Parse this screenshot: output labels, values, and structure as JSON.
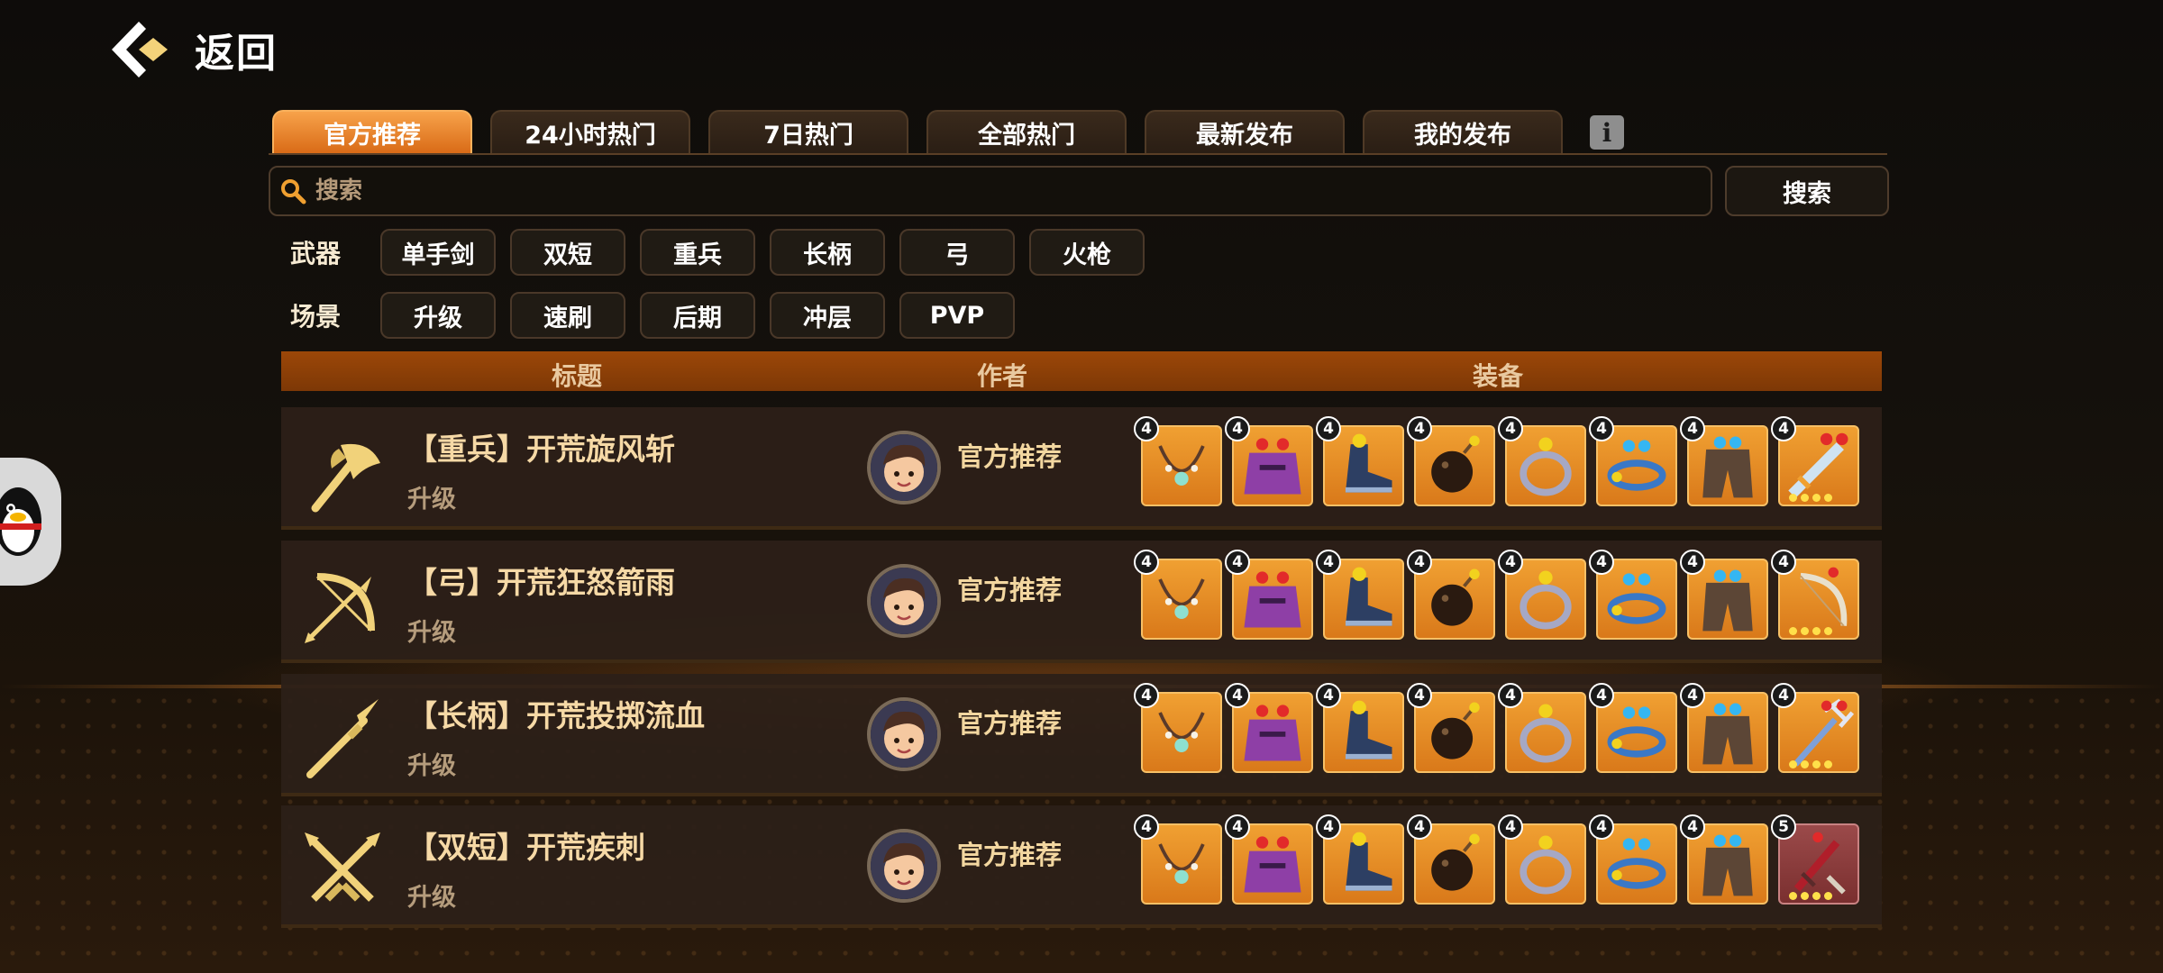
{
  "nav": {
    "back_label": "返回"
  },
  "tabs": [
    {
      "label": "官方推荐",
      "active": true
    },
    {
      "label": "24小时热门",
      "active": false
    },
    {
      "label": "7日热门",
      "active": false
    },
    {
      "label": "全部热门",
      "active": false
    },
    {
      "label": "最新发布",
      "active": false
    },
    {
      "label": "我的发布",
      "active": false
    }
  ],
  "info_icon": "i",
  "search": {
    "placeholder": "搜索",
    "button_label": "搜索"
  },
  "filters": {
    "weapon": {
      "label": "武器",
      "options": [
        "单手剑",
        "双短",
        "重兵",
        "长柄",
        "弓",
        "火枪"
      ]
    },
    "scene": {
      "label": "场景",
      "options": [
        "升级",
        "速刷",
        "后期",
        "冲层",
        "PVP"
      ]
    }
  },
  "table": {
    "headers": {
      "title": "标题",
      "author": "作者",
      "equipment": "装备"
    },
    "rows": [
      {
        "title": "【重兵】开荒旋风斩",
        "tag": "升级",
        "author": "官方推荐",
        "weapon_icon": "axe-icon",
        "equip_levels": [
          "4",
          "4",
          "4",
          "4",
          "4",
          "4",
          "4",
          "4"
        ],
        "last_item_icon": "sword-icon"
      },
      {
        "title": "【弓】开荒狂怒箭雨",
        "tag": "升级",
        "author": "官方推荐",
        "weapon_icon": "bow-icon",
        "equip_levels": [
          "4",
          "4",
          "4",
          "4",
          "4",
          "4",
          "4",
          "4"
        ],
        "last_item_icon": "bow-icon"
      },
      {
        "title": "【长柄】开荒投掷流血",
        "tag": "升级",
        "author": "官方推荐",
        "weapon_icon": "spear-icon",
        "equip_levels": [
          "4",
          "4",
          "4",
          "4",
          "4",
          "4",
          "4",
          "4"
        ],
        "last_item_icon": "trident-icon"
      },
      {
        "title": "【双短】开荒疾刺",
        "tag": "升级",
        "author": "官方推荐",
        "weapon_icon": "daggers-icon",
        "equip_levels": [
          "4",
          "4",
          "4",
          "4",
          "4",
          "4",
          "4",
          "5"
        ],
        "last_item_icon": "dagger-icon"
      }
    ]
  },
  "equip_icons": [
    "necklace-icon",
    "cape-icon",
    "boot-icon",
    "bomb-icon",
    "ring-icon",
    "bracelet-icon",
    "pants-icon"
  ],
  "colors": {
    "accent": "#e8892a",
    "header_bar": "#8e4007",
    "slot": "#e88d25",
    "gold_text": "#f6d9a6"
  }
}
